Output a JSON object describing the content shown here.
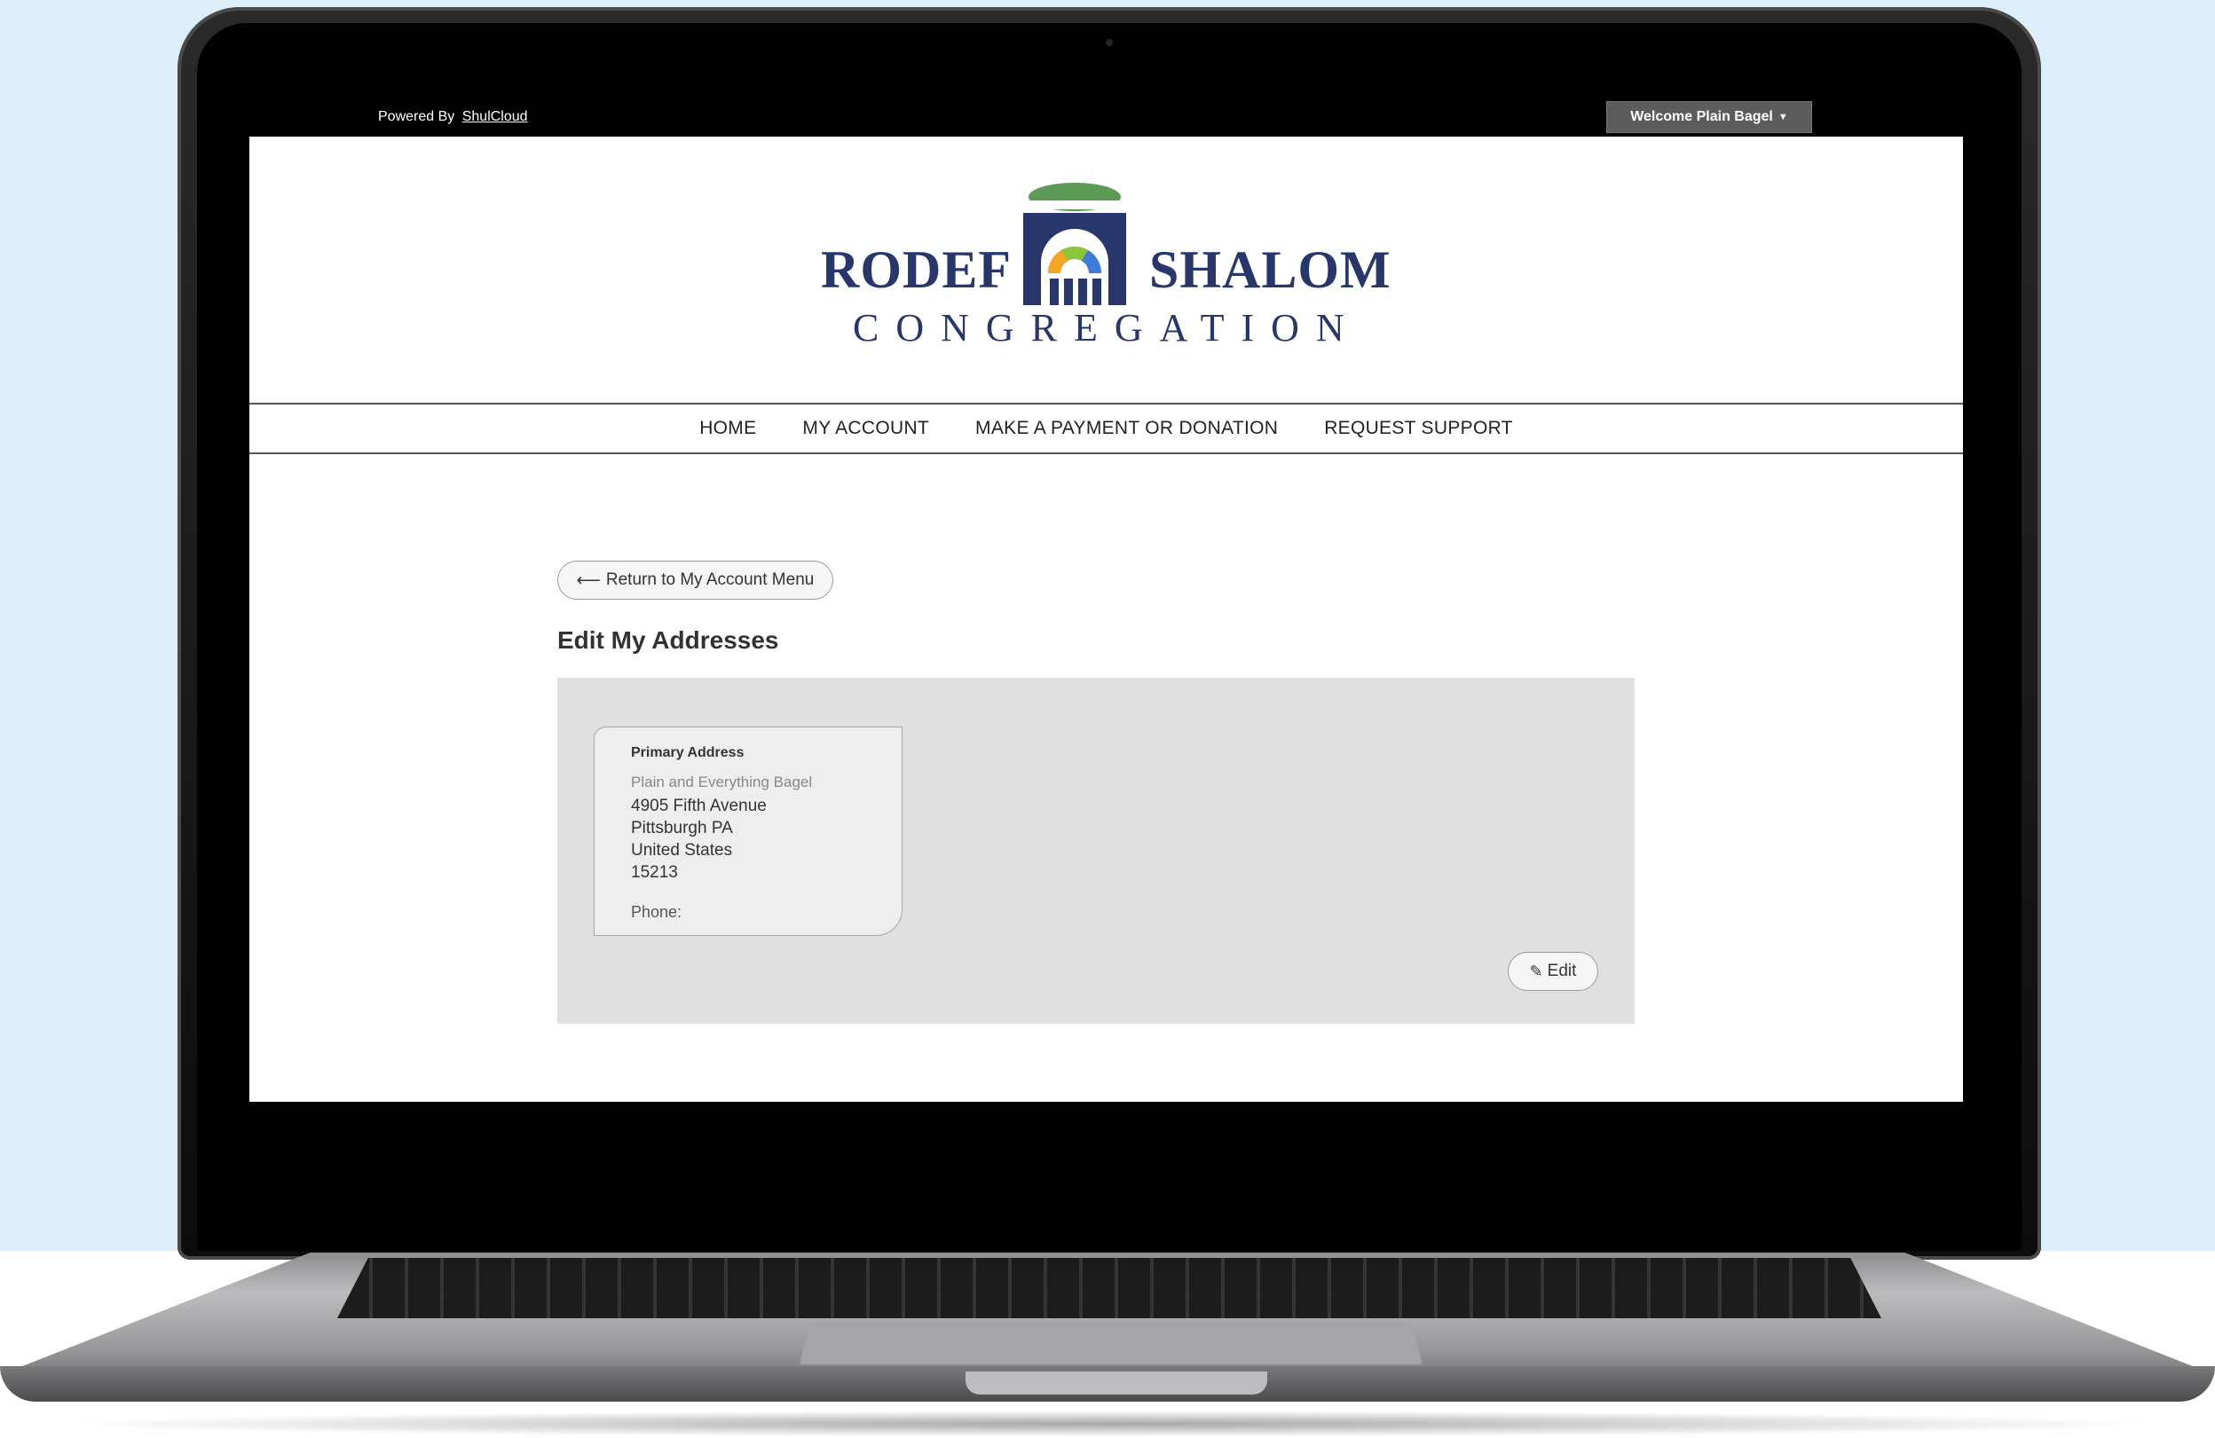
{
  "topbar": {
    "powered_label": "Powered By",
    "powered_link": "ShulCloud",
    "welcome": "Welcome Plain Bagel",
    "welcome_caret": "▼"
  },
  "logo": {
    "word1": "RODEF",
    "word2": "SHALOM",
    "line2": "CONGREGATION"
  },
  "nav": {
    "items": [
      "HOME",
      "MY ACCOUNT",
      "MAKE A PAYMENT OR DONATION",
      "REQUEST SUPPORT"
    ]
  },
  "main": {
    "return_arrow": "⟵",
    "return_label": "Return to My Account Menu",
    "title": "Edit My Addresses",
    "address": {
      "title": "Primary Address",
      "name": "Plain and Everything Bagel",
      "street": "4905 Fifth Avenue",
      "city_state": "Pittsburgh PA",
      "country": "United States",
      "zip": "15213",
      "phone_label": "Phone:"
    },
    "edit_icon": "✎",
    "edit_label": "Edit"
  },
  "colors": {
    "brand_navy": "#27366b",
    "brand_green": "#5e9a57",
    "panel_bg": "#e0e0e0",
    "background": "#dbeef9"
  },
  "icons": {
    "laptop": "laptop-frame",
    "logo": "arch-logo-icon",
    "return": "arrow-left-icon",
    "edit": "pencil-icon"
  }
}
